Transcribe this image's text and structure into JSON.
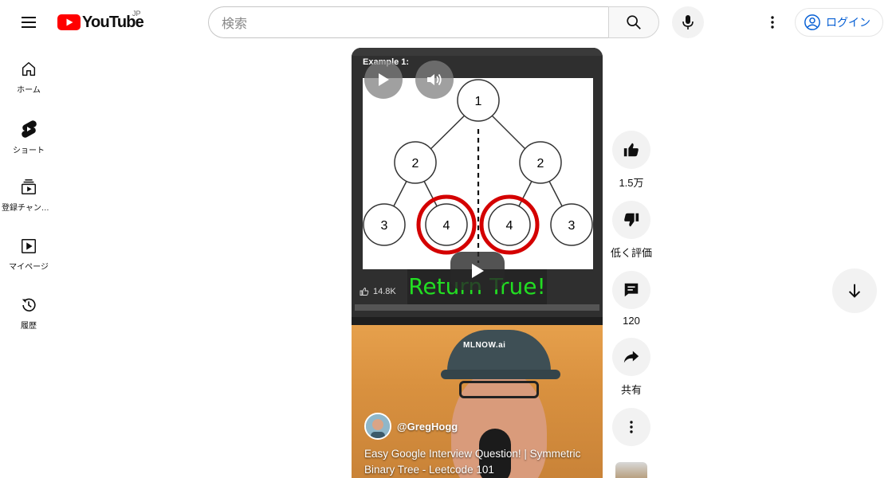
{
  "header": {
    "logo_text": "YouTube",
    "country_code": "JP",
    "search_placeholder": "検索",
    "login_label": "ログイン"
  },
  "sidebar": {
    "items": [
      {
        "label": "ホーム",
        "icon": "home-icon"
      },
      {
        "label": "ショート",
        "icon": "shorts-icon"
      },
      {
        "label": "登録チャンネル",
        "icon": "subscriptions-icon"
      },
      {
        "label": "マイページ",
        "icon": "library-icon"
      },
      {
        "label": "履歴",
        "icon": "history-icon"
      }
    ]
  },
  "video": {
    "example_label": "Example 1:",
    "overlay_caption": "Return True!",
    "inner_like_count": "14.8K",
    "tree": {
      "root": "1",
      "level2": [
        "2",
        "2"
      ],
      "level3": [
        "3",
        "4",
        "4",
        "3"
      ]
    },
    "channel_handle": "@GregHogg",
    "cap_text": "MLNOW.ai",
    "title": "Easy Google Interview Question! | Symmetric Binary Tree - Leetcode 101"
  },
  "actions": {
    "like_count": "1.5万",
    "dislike_label": "低く評価",
    "comment_count": "120",
    "share_label": "共有"
  },
  "colors": {
    "brand_red": "#ff0000",
    "link_blue": "#065fd4",
    "caption_green": "#22dd22",
    "highlight_red": "#d40000"
  }
}
